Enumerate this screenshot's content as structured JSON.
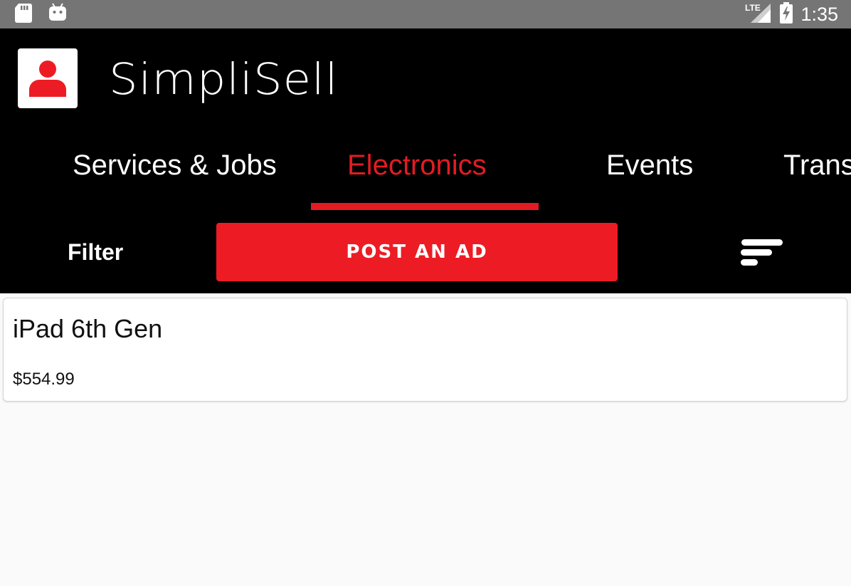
{
  "status_bar": {
    "time": "1:35",
    "network": "LTE",
    "icons": [
      "sd-card-icon",
      "android-icon",
      "signal-icon",
      "battery-charging-icon"
    ]
  },
  "app": {
    "title": "SimpliSell",
    "logo_icon": "user-avatar-icon"
  },
  "tabs": [
    {
      "label": "Services & Jobs",
      "active": false
    },
    {
      "label": "Electronics",
      "active": true
    },
    {
      "label": "Events",
      "active": false
    },
    {
      "label": "Trans",
      "active": false
    }
  ],
  "toolbar": {
    "filter_label": "Filter",
    "post_ad_label": "POST AN AD",
    "sort_icon": "sort-icon"
  },
  "listings": [
    {
      "title": "iPad 6th Gen",
      "price": "$554.99"
    }
  ],
  "colors": {
    "accent": "#ed1c24",
    "appbar": "#000000",
    "statusbar": "#757575",
    "background": "#fafafa"
  }
}
